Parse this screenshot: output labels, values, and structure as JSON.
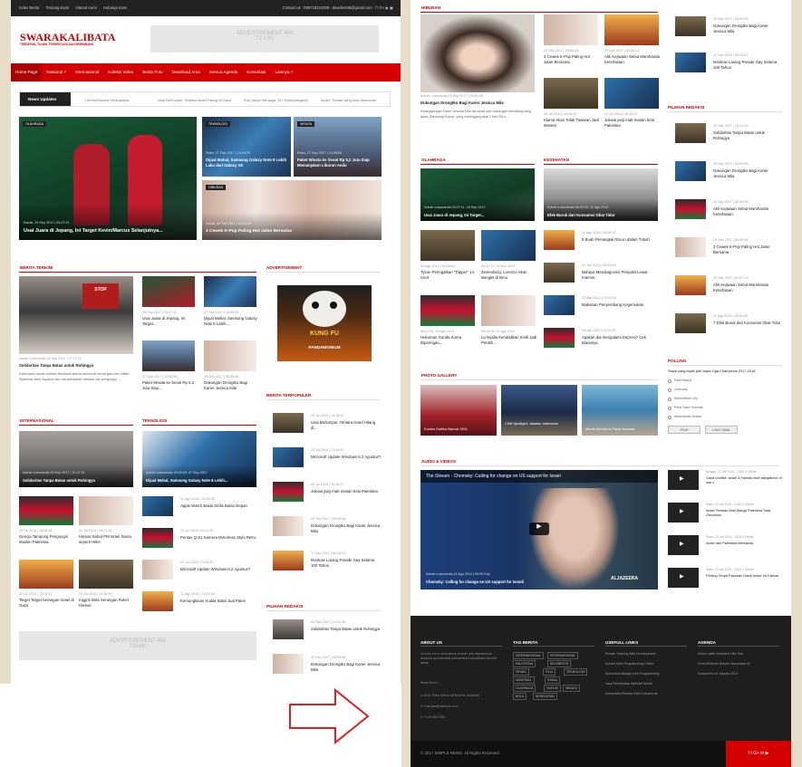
{
  "colors": {
    "accent": "#d40000",
    "dark": "#222222",
    "footer": "#1e1e1e",
    "bg": "#e8dccb"
  },
  "topbar": {
    "links": [
      "Index Berita",
      "Tentang Kami",
      "Alamat Kami",
      "Hubungi Kami"
    ],
    "contact": "Contact us : 085718224299 - davidnet46@gmail.com",
    "social": "f  t  G+  ▶  ▣"
  },
  "brand": {
    "name": "SWARAKALIBATA",
    "tagline": "TERDEPAN, TAJAM, TERPERCAYA DAN BERIMBANG"
  },
  "ad": {
    "top": "ADVERTISEMENT 468\n72 x 90",
    "bottom": "ADVERTISEMENT 468\n728x90"
  },
  "nav": [
    "Home Page",
    "Nasional ˅",
    "Internasional",
    "Koleksi Video",
    "Berita Foto",
    "Download Area",
    "Semua Agenda",
    "Konsultasi",
    "Lainnya ˅"
  ],
  "ticker": {
    "label": "News Updates",
    "items": [
      "l Kevin/Marcus Selanjutnya",
      "Usai Berlumpur, Tentara Israel Hilang di Gaza",
      "Roy Suryo Menjaga, DIY Diperjuangkan",
      "Israel, Tuntas yang bisa Dibancurk"
    ]
  },
  "hero": {
    "main": {
      "badge": "OLAHRAGA",
      "meta": "Kamis, 28 Sep 2017 | 03:27:11",
      "title": "Usai Juara di Jepang, Ini Target Kevin/Marcus Selanjutnya..."
    },
    "tr1": {
      "badge": "TEKNOLOGI",
      "meta": "Rabu, 27 Sep 2017 | 14:49:29",
      "title": "Dijual Mahal, Samsung Galaxy Note 8 Lebih Laku dari Galaxy S8"
    },
    "tr2": {
      "badge": "WISATA",
      "meta": "Rabu, 27 Sep 2017 | 14:08:58",
      "title": "Paket Wisata ke Seoul Rp 5,2 Juta Siap Memanjakan Liburan Anda"
    },
    "br": {
      "badge": "HIBURAN",
      "meta": "Jumat, 29 Sep 2017 | 05:50:08",
      "title": "3 Cewek K-Pop Paling Hot Jalan Bersama"
    }
  },
  "berita_terkini": {
    "title": "BERITA TERKINI",
    "main": {
      "meta": "Admin Lokomedia  25 Sep 2017 | 07:27:11",
      "title": "Solidaritas Tanpa Batas untuk Rohingya",
      "excerpt": "Kekerasan pecah setelah Berbekal aktivis kelompok bersenjata dan militer Myanmar akhir Agustus lalu menyebabkan ratusan ribu pengungsi ..."
    },
    "items": [
      {
        "meta": "28 Sep 2017 | 03:27:11",
        "title": "Usai Juara di Jepang, Ini Target..."
      },
      {
        "meta": "27 Sep 2017 | 14:49:29",
        "title": "Dijual Mahal, Samsung Galaxy Note 8 Lebih..."
      },
      {
        "meta": "27 Sep 2017 | 14:08:58",
        "title": "Paket Wisata ke Seoul Rp 5,2 Juta Siap..."
      },
      {
        "meta": "29 Sep 2017 | 05:50:08",
        "title": "Dokungan Drongtko Bagi Karier Jessica Mila"
      }
    ]
  },
  "advertisement": {
    "title": "ADVERTISEMENT",
    "poster_top": "KUNG FU",
    "poster_bottom": "PANDAMONIUM"
  },
  "berita_terpopuler": {
    "title": "BERITA TERPOPULER",
    "items": [
      {
        "meta": "25 Jul 2014 | 14:18:41",
        "title": "Usai Berlumpur, Tentara Israel Hilang di..."
      },
      {
        "meta": "22 Jul 2014 | 21:15:52",
        "title": "Microsoft Update Windows 8.2 Agustus?"
      },
      {
        "meta": "26 Jul 2014 | 19:15:27",
        "title": "Jokowi janji mati-matian bela Palestina"
      },
      {
        "meta": "29 Sep 2017 | 05:50:08",
        "title": "Dokungan Drongtko Bagi Karier Jessica Mila"
      },
      {
        "meta": "17 Nov 2012 | 06:43:57",
        "title": "Moskow Larang Parade Gay Selama 100 Tahun"
      }
    ]
  },
  "pilihan_redaksi_left": {
    "title": "PILIHAN REDAKSI",
    "items": [
      {
        "meta": "25 Sep 2017 | 10:31:06",
        "title": "Solidaritas Tanpa Batas untuk Rohingya"
      },
      {
        "meta": "29 Sep 2017 | 05:50:08",
        "title": "Dokungan Drongtko Bagi Karier Jessica Mila"
      }
    ]
  },
  "internasional": {
    "title": "INTERNASIONAL",
    "main": {
      "meta": "Admin Lokomedia  25 Sep 2017 | 10:27:11",
      "title": "Solidaritas Tanpa Batas untuk Rohingya"
    },
    "items": [
      {
        "meta": "22 Jul 2014 | 15:54:48",
        "title": "Gencja Tampung Pengungsi Muslim Palestina"
      },
      {
        "meta": "24 Jul 2014 | 14:27:15",
        "title": "Hamas Sebut PM Israel Sama seperti Hitler"
      },
      {
        "meta": "22 Jul 2014 | 15:20:01",
        "title": "Target Target berangan Israel di Gaza"
      },
      {
        "meta": "24 Jul 2014 | 14:40:59",
        "title": "Inggris Bela Serangan Roket Hamas"
      }
    ]
  },
  "teknologi": {
    "title": "TEKNOLOGI",
    "main": {
      "meta": "Admin Lokomedia  15:49:29, 27 Sep 2017",
      "title": "Dijual Mahal, Samsung Galaxy Note 8 Lebih..."
    },
    "items": [
      {
        "meta": "11 Agu 2014 | 00:04:09",
        "title": "Apple Watch Bakal Dirilis Bulan Depan"
      },
      {
        "meta": "22 Jul 2014 | 01:41:22",
        "title": "Pentax Q-S1 Kamera Mirrorless Stylo Retro"
      },
      {
        "meta": "22 Jul 2014 | 21:20:22",
        "title": "Microsoft Update Windows 8.2 Agustus?"
      },
      {
        "meta": "11 Agu 2014 | 23:07:43",
        "title": "Kemungkinan Kodak Batal Jual Paten"
      }
    ]
  },
  "hiburan": {
    "title": "HIBURAN",
    "main": {
      "meta": "Admin Lokomedia  29 Sep 2017 | 05:50:08",
      "title": "Dukungan Drongtko Bagi Karier Jessica Mila",
      "excerpt": "Kelangsungan Karier Jessica Mila tak lepas dari dukungan mendiang sang ayah, Bambang Suteja, yang meninggal pada 2 Mei 2014, ..."
    },
    "items": [
      {
        "meta": "29 Sep 2017 | 05:50:08",
        "title": "3 Cewek K-Pop Paling Hot Jalan Bersama"
      },
      {
        "meta": "29 Sep 2017 | 00:08:14",
        "title": "Ahli Kejiwaan Sebut Marshanda Keterlaluan"
      },
      {
        "meta": "25 Jul 2014 | 14:39:10",
        "title": "Klarna Akan Tolak Tawaran Jadi Menteri"
      },
      {
        "meta": "24 Jul 2014 | 19:16:27",
        "title": "Jokowi janji mati-matian bela Palestina"
      }
    ]
  },
  "olahraga": {
    "title": "OLAHRAGA",
    "main": {
      "meta": "Admin Lokomedia  03:27:11, 28 Sep 2017",
      "title": "Usai Juara di Jepang, Ini Target..."
    },
    "items": [
      {
        "meta": "03 Agu 2012 | 04:55:41",
        "title": "Tyson Peringatkan \"Tapper\" 14 Cent"
      },
      {
        "meta": "05:12:37, 23 Nov 2012",
        "title": "Zeelenberg: Lorenzo Akan Bangkit di Brno"
      },
      {
        "meta": "05:47:26, 25 Agu 2012",
        "title": "Hukuman Gunda Korea Diperingan,..."
      },
      {
        "meta": "05:10:00, 22 Agu 2012",
        "title": "La Nyalla Kembalikan Kinifi Jadi Petatih..."
      }
    ]
  },
  "kesehatan": {
    "title": "KESEHATAN",
    "main": {
      "meta": "Admin Lokomedia  08:52:26, 11 Agu 2014",
      "title": "Efek Buruk dari Konsumsi Obat Tidur"
    },
    "items": [
      {
        "meta": "11 Agu 2014 | 08:46:47",
        "title": "5 Buah Penangkal Racun dalam Tubuh"
      },
      {
        "meta": "10 Jan 2013 | 05:16:49",
        "title": "Bahaya Mendiagnosis Penyakit Lewat Internet"
      },
      {
        "meta": "22 Agu 2012 | 10:52:03",
        "title": "Makanan Penyembang Kegemukan"
      },
      {
        "meta": "28 Agu 2012 | 11:52:07",
        "title": "Apakah dia mengalami Depresi? Cek Biasanya"
      }
    ]
  },
  "photo_gallery": {
    "title": "PHOTO GALLERY",
    "items": [
      "Kontes Kartika Barock 2011",
      "CNN Spotlight: Jakarta, Indonesia",
      "Murah Meriah di Pasar Avenida"
    ]
  },
  "audio_video": {
    "title": "AUDIO & VIDEOS",
    "video_title": "The Stream - Chomsky: Calling for change on US support for Israel",
    "video_meta": "Admin Lokomedia  11 Agu 2014 | 09:09 Kali",
    "video_caption": "Chomsky: Calling for change on US support for Israeli",
    "brand": "ALJAZEERA",
    "list": [
      {
        "meta": "Minggu, 27 Juli 2014 - 2536 X Dilihat",
        "title": "Gaza conflict: Israel & Hamas face allegations of war c"
      },
      {
        "meta": "Rabu, 23 Juli 2014 - 2180 X Dilihat",
        "title": "Israel Tembak Mati Warga Palestina Saat Gencatan"
      },
      {
        "meta": "Rabu, 23 Juli 2014 - 1925 X Dilihat",
        "title": "Israel dan Palestina Memanas"
      },
      {
        "meta": "Rabu, 23 Juli 2014 - 2146 X Dilihat",
        "title": "Perang Tenpit Pasukan Darat Israel Vs Hamas"
      }
    ]
  },
  "sidebar_right": {
    "top": [
      {
        "meta": "29 Sep 2017 | 05:50:08",
        "title": "Dokungan Drongtko Bagi Karier Jessica Mila"
      },
      {
        "meta": "17 Nov 2012 | 06:43:57",
        "title": "Moskow Larang Parade Gay Selama 100 Tahun"
      }
    ],
    "pilihan_title": "PILIHAN REDAKSI",
    "pilihan": [
      {
        "meta": "25 Sep 2017 | 10:31:06",
        "title": "Solidaritas Tanpa Batas untuk Rohingya"
      },
      {
        "meta": "29 Sep 2017 | 05:50:08",
        "title": "Dokungan Drongtko Bagi Karier Jessica Mila"
      },
      {
        "meta": "29 Sep 2017 | 00:50:08",
        "title": "Ahli Kejiwaan Sebut Marshanda Keterlaluan"
      },
      {
        "meta": "29 Sep 2017 | 05:50:08",
        "title": "3 Cewek K-Pop Paling Hot Jalan Bersama"
      },
      {
        "meta": "29 Sep 2017 | 00:07:14",
        "title": "Ahli Kejiwaan Sebut Marshanda Keterlaluan"
      },
      {
        "meta": "11 Agu 2014 | 08:52:26",
        "title": "7 Efek Buruk dari Konsumsi Obat Tidur"
      }
    ],
    "polling_title": "POLLING",
    "poll_q": "Siapa yang layak jadi Juara Liga Champions 2017-2018",
    "poll_opts": [
      "Real Madrid",
      "Juventus",
      "Manchester City",
      "Paris Saint Germain",
      "Manchester United"
    ],
    "poll_btn1": "PILIH",
    "poll_btn2": "LIHAT HASIL"
  },
  "footer": {
    "about_title": "ABOUT US",
    "about_text": "Ut enim ad m accusamus et iusto odio dignissimos ducimus qui blanditiis praesentium voluptatum deleniti atque.",
    "read_more": "Read More »",
    "address": "1615, Patio Street, Melbourne, Australia",
    "email": "example@example.com",
    "phone": "+123 456 7890",
    "tag_title": "TAG BERITA",
    "tags": [
      "INTERNASIONAL",
      "INTERNASIONAL",
      "PALESTINA",
      "SELEBRITIS",
      "ISRAEL",
      "FILM",
      "TEKNOLOGI",
      "NASIONAL",
      "KANAL",
      "OLAHRAGA",
      "HUKUM",
      "WISATA",
      "BOLA",
      "KESEHATAN"
    ],
    "links_title": "USEFULL LINKS",
    "links": [
      "Private Training Web Development",
      "Kursus Web Programming Online",
      "Komunitas Belajar web Programming",
      "Jasa Pembuatan Website Murah",
      "Komunitas Pecinta CMS Lokomedia"
    ],
    "agenda_title": "AGENDA",
    "agenda": [
      "Kitsch Jaffer Deadash Hits Tour",
      "Festival Musik Rambu Nusantara 20",
      "Konsumen ke Jakarta 2013"
    ],
    "copyright": "© 2017 SIMPLE NEWS. All Rights Reserved.",
    "social": "f  t  G+  in  ▶"
  }
}
